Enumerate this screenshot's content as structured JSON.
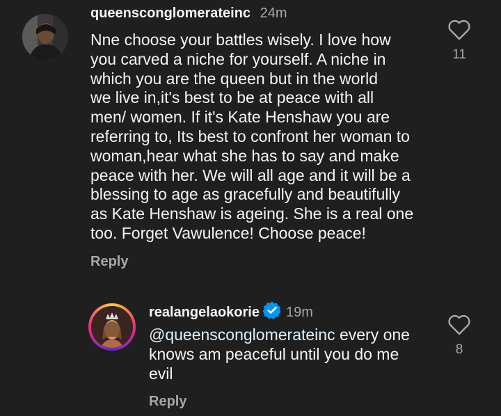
{
  "comments": [
    {
      "username": "queensconglomerateinc",
      "time": "24m",
      "text": "Nne choose your battles wisely. I love how\nyou carved a niche for yourself. A niche in\nwhich you are the queen but in the world\nwe live in,it's best to be at peace with all\nmen/ women. If it's Kate Henshaw you are\nreferring to, Its best to confront her woman to\nwoman,hear what she has to say and make\npeace with her. We will all age and it will be a\nblessing to age as gracefully and beautifully\nas Kate Henshaw is ageing. She is a real one\ntoo. Forget Vawulence! Choose peace!",
      "reply_label": "Reply",
      "like_count": "11"
    }
  ],
  "reply": {
    "username": "realangelaokorie",
    "verified": true,
    "time": "19m",
    "mention": "@queensconglomerateinc",
    "text": " every one\nknows am peaceful until you do me\nevil",
    "reply_label": "Reply",
    "like_count": "8"
  },
  "colors": {
    "background": "#1f1f1f",
    "text_primary": "#f5f5f5",
    "text_secondary": "#a8a8a8",
    "verified_blue": "#0095f6"
  },
  "icons": [
    "heart-outline-icon",
    "verified-badge-icon",
    "avatar"
  ]
}
